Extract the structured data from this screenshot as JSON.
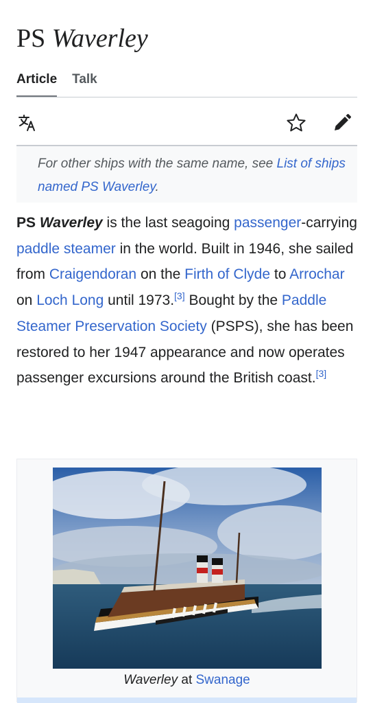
{
  "article": {
    "title_prefix": "PS",
    "title_italic": "Waverley"
  },
  "tabs": [
    {
      "label": "Article",
      "active": true
    },
    {
      "label": "Talk",
      "active": false
    }
  ],
  "toolbar": {
    "language_icon": "translate-icon",
    "watch_icon": "star-icon",
    "edit_icon": "pencil-icon"
  },
  "hatnote": {
    "text": "For other ships with the same name, see ",
    "link": "List of ships named PS Waverley",
    "end": "."
  },
  "lead": {
    "bold_prefix": "PS ",
    "bold_italic": "Waverley",
    "t1": " is the last seagoing ",
    "l1": "passenger",
    "t2": "-carrying ",
    "l2": "paddle steamer",
    "t3": " in the world. Built in 1946, she sailed from ",
    "l3": "Craigendoran",
    "t4": " on the ",
    "l4": "Firth of Clyde",
    "t5": " to ",
    "l5": "Arrochar",
    "t6": " on ",
    "l6": "Loch Long",
    "t7": " until 1973.",
    "ref1": "[3]",
    "t8": " Bought by the ",
    "l7": "Paddle Steamer Preservation Society",
    "t9": " (PSPS), she has been restored to her 1947 appearance and now operates passenger excursions around the British coast.",
    "ref2": "[3]"
  },
  "figure": {
    "caption_italic": "Waverley",
    "caption_text": " at ",
    "caption_link": "Swanage"
  },
  "colors": {
    "link": "#3366cc",
    "text": "#202122",
    "muted": "#54595d",
    "hatnote_bg": "#f8f9fa"
  }
}
